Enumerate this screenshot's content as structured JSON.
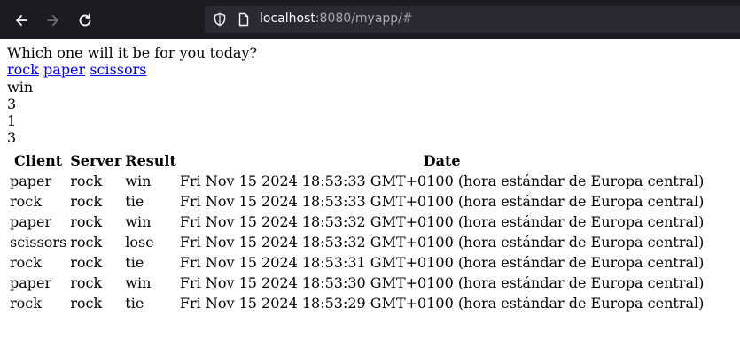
{
  "browser": {
    "url_host": "localhost",
    "url_rest": ":8080/myapp/#"
  },
  "page": {
    "prompt": "Which one will it be for you today?",
    "choices": [
      "rock",
      "paper",
      "scissors"
    ],
    "result": "win",
    "stat_1": "3",
    "stat_2": "1",
    "stat_3": "3"
  },
  "table": {
    "headers": [
      "Client",
      "Server",
      "Result",
      "Date"
    ],
    "rows": [
      [
        "paper",
        "rock",
        "win",
        "Fri Nov 15 2024 18:53:33 GMT+0100 (hora estándar de Europa central)"
      ],
      [
        "rock",
        "rock",
        "tie",
        "Fri Nov 15 2024 18:53:33 GMT+0100 (hora estándar de Europa central)"
      ],
      [
        "paper",
        "rock",
        "win",
        "Fri Nov 15 2024 18:53:32 GMT+0100 (hora estándar de Europa central)"
      ],
      [
        "scissors",
        "rock",
        "lose",
        "Fri Nov 15 2024 18:53:32 GMT+0100 (hora estándar de Europa central)"
      ],
      [
        "rock",
        "rock",
        "tie",
        "Fri Nov 15 2024 18:53:31 GMT+0100 (hora estándar de Europa central)"
      ],
      [
        "paper",
        "rock",
        "win",
        "Fri Nov 15 2024 18:53:30 GMT+0100 (hora estándar de Europa central)"
      ],
      [
        "rock",
        "rock",
        "tie",
        "Fri Nov 15 2024 18:53:29 GMT+0100 (hora estándar de Europa central)"
      ]
    ]
  }
}
